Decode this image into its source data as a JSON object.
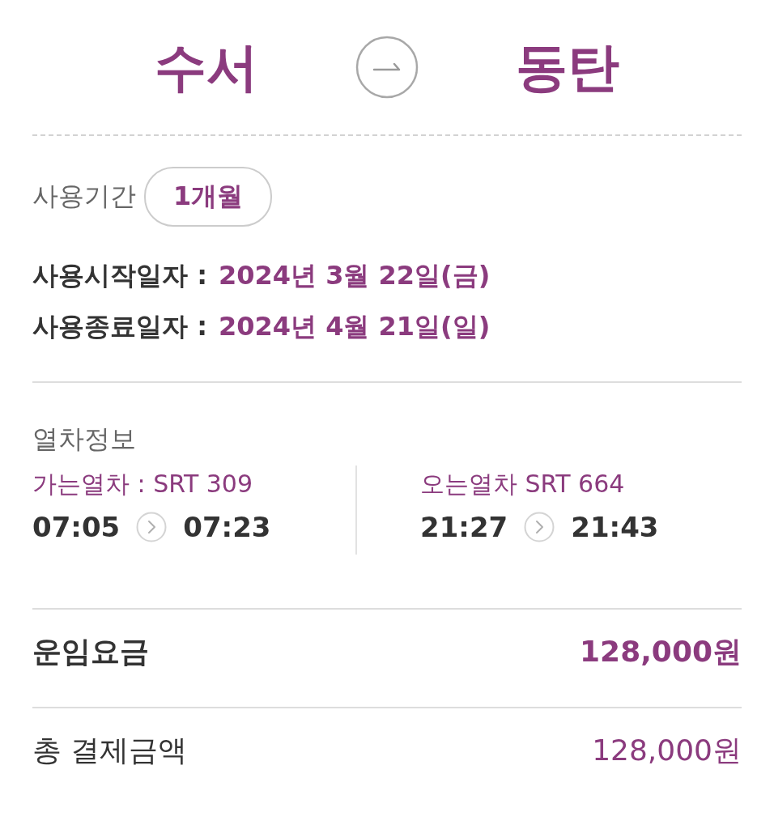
{
  "route": {
    "origin": "수서",
    "destination": "동탄"
  },
  "period": {
    "label": "사용기간",
    "value": "1개월"
  },
  "dates": [
    {
      "label": "사용시작일자 :",
      "value": "2024년 3월 22일(금)"
    },
    {
      "label": "사용종료일자 :",
      "value": "2024년 4월 21일(일)"
    }
  ],
  "train_info": {
    "title": "열차정보",
    "trains": [
      {
        "label": "가는열차 : SRT 309",
        "departure": "07:05",
        "arrival": "07:23"
      },
      {
        "label": "오는열차 SRT 664",
        "departure": "21:27",
        "arrival": "21:43"
      }
    ]
  },
  "fares": [
    {
      "kind": "fare",
      "label": "운임요금",
      "amount": "128,000원"
    },
    {
      "kind": "total",
      "label": "총 결제금액",
      "amount": "128,000원"
    }
  ]
}
